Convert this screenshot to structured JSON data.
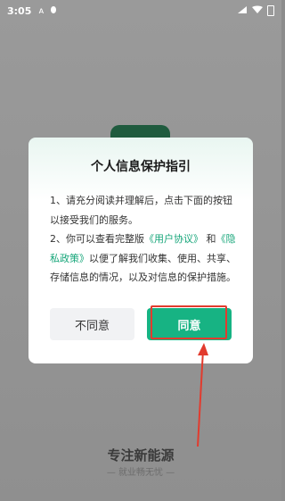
{
  "status_bar": {
    "time": "3:05",
    "icons": [
      "a-icon",
      "bug-icon"
    ],
    "right_icons": [
      "signal-icon",
      "wifi-icon",
      "battery-icon"
    ]
  },
  "background": {
    "brand_title": "专注新能源",
    "brand_subtitle": "— 就业畅无忧 —"
  },
  "dialog": {
    "title": "个人信息保护指引",
    "p1": "1、请充分阅读并理解后，点击下面的按钮以接受我们的服务。",
    "p2_a": "2、你可以查看完整版",
    "link_user_agreement": "《用户协议》",
    "p2_and": "和",
    "link_privacy_policy": "《隐私政策》",
    "p2_b": "以便了解我们收集、使用、共享、存储信息的情况，以及对信息的保护措施。",
    "disagree_label": "不同意",
    "agree_label": "同意"
  },
  "colors": {
    "accent": "#17b383",
    "link": "#17a67a",
    "highlight": "#e23b2e"
  }
}
